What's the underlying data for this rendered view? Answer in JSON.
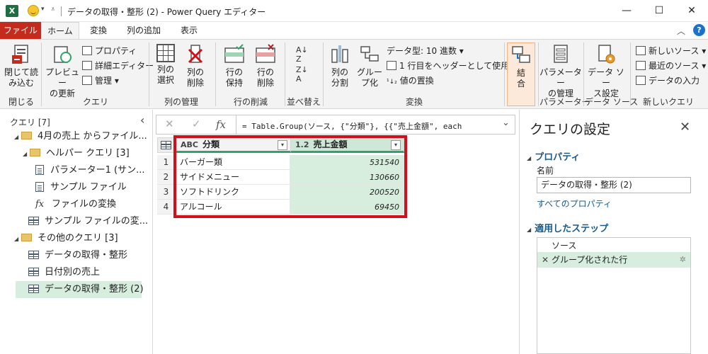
{
  "window": {
    "title": "データの取得・整形 (2) - Power Query エディター",
    "app_icon": "X",
    "minimize": "—",
    "maximize": "☐",
    "close": "✕"
  },
  "tabs": {
    "file": "ファイル",
    "home": "ホーム",
    "transform": "変換",
    "add_column": "列の追加",
    "view": "表示",
    "help": "?"
  },
  "ribbon": {
    "close_group": {
      "label": "閉じる",
      "close_load": "閉じて読\nみ込む"
    },
    "query_group": {
      "label": "クエリ",
      "refresh_preview": "プレビュー\nの更新",
      "properties": "プロパティ",
      "advanced_editor": "詳細エディター",
      "manage": "管理"
    },
    "manage_columns_group": {
      "label": "列の管理",
      "choose_columns": "列の\n選択",
      "remove_columns": "列の\n削除"
    },
    "reduce_rows_group": {
      "label": "行の削減",
      "keep_rows": "行の\n保持",
      "remove_rows": "行の\n削除"
    },
    "sort_group": {
      "label": "並べ替え"
    },
    "transform_group": {
      "label": "変換",
      "split_column": "列の\n分割",
      "group_by": "グルー\nプ化",
      "data_type": "データ型: 10 進数",
      "use_first_row": "1 行目をヘッダーとして使用",
      "replace_values": "値の置換"
    },
    "combine_group": {
      "label": "",
      "combine": "結\n合"
    },
    "parameters_group": {
      "label": "パラメーター",
      "manage_parameters": "パラメーター\nの管理"
    },
    "data_sources_group": {
      "label": "データ ソース",
      "data_source_settings": "データ ソー\nス設定"
    },
    "new_query_group": {
      "label": "新しいクエリ",
      "new_source": "新しいソース",
      "recent_sources": "最近のソース",
      "enter_data": "データの入力"
    }
  },
  "left_pane": {
    "header": "クエリ [7]",
    "items": [
      {
        "label": "4月の売上 からファイル...",
        "kind": "folder"
      },
      {
        "label": "ヘルパー クエリ [3]",
        "kind": "folder"
      },
      {
        "label": "パラメーター1 (サン...",
        "kind": "param"
      },
      {
        "label": "サンプル ファイル",
        "kind": "doc"
      },
      {
        "label": "ファイルの変換",
        "kind": "fx"
      },
      {
        "label": "サンプル ファイルの変...",
        "kind": "table"
      },
      {
        "label": "その他のクエリ [3]",
        "kind": "folder"
      },
      {
        "label": "データの取得・整形",
        "kind": "table"
      },
      {
        "label": "日付別の売上",
        "kind": "table"
      },
      {
        "label": "データの取得・整形 (2)",
        "kind": "table",
        "selected": true
      }
    ]
  },
  "formula_bar": {
    "cancel": "✕",
    "commit": "✓",
    "fx": "fx",
    "text": "= Table.Group(ソース, {\"分類\"}, {{\"売上金額\", each"
  },
  "grid": {
    "columns": [
      {
        "type": "ABC",
        "name": "分類"
      },
      {
        "type": "1.2",
        "name": "売上金額"
      }
    ],
    "rows": [
      {
        "n": "1",
        "category": "バーガー類",
        "amount": "531540"
      },
      {
        "n": "2",
        "category": "サイドメニュー",
        "amount": "130660"
      },
      {
        "n": "3",
        "category": "ソフトドリンク",
        "amount": "200520"
      },
      {
        "n": "4",
        "category": "アルコール",
        "amount": "69450"
      }
    ]
  },
  "right_pane": {
    "title": "クエリの設定",
    "properties_header": "プロパティ",
    "name_label": "名前",
    "name_value": "データの取得・整形 (2)",
    "all_properties": "すべてのプロパティ",
    "applied_steps_header": "適用したステップ",
    "steps": [
      {
        "label": "ソース"
      },
      {
        "label": "グループ化された行",
        "selected": true
      }
    ]
  },
  "colors": {
    "file_tab": "#c42b1c",
    "accent_green": "#2ea36a",
    "selected_bg": "#d7eedf",
    "highlight_box": "#d0101b",
    "link_blue": "#1a5a8a"
  }
}
